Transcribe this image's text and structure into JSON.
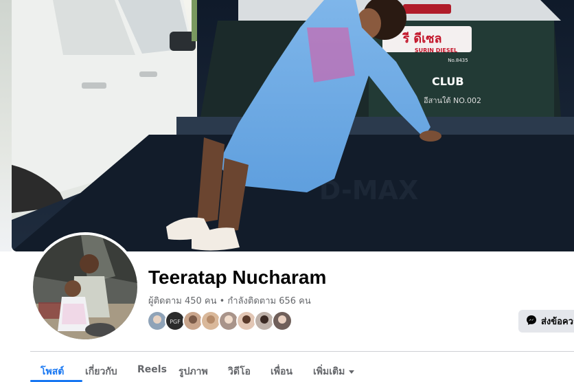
{
  "profile": {
    "name": "Teeratap Nucharam",
    "stats": "ผู้ติดตาม 450 คน • กำลังติดตาม 656 คน"
  },
  "cover": {
    "sign_top": "รี ดีเซล",
    "sign_sub": "SURIN DIESEL",
    "sign_num": "No.8435",
    "club": "CLUB",
    "club_sub": "อีสานใต้ NO.002",
    "tailgate": "D-MAX"
  },
  "actions": {
    "message_label": "ส่งข้อความ"
  },
  "friends": {
    "avatars": [
      "friend-avatar-1",
      "friend-avatar-2",
      "friend-avatar-3",
      "friend-avatar-4",
      "friend-avatar-5",
      "friend-avatar-6",
      "friend-avatar-7",
      "friend-avatar-8"
    ],
    "colors": [
      "#8fa3b8",
      "#2b2b2b",
      "#c9a58c",
      "#d9b89a",
      "#a9948a",
      "#e2c6b4",
      "#bfb2aa",
      "#6f5f5a"
    ],
    "second_label": "PGF"
  },
  "tabs": [
    {
      "label": "โพสต์",
      "active": true
    },
    {
      "label": "เกี่ยวกับ",
      "active": false
    },
    {
      "label": "Reels",
      "active": false
    },
    {
      "label": "รูปภาพ",
      "active": false
    },
    {
      "label": "วิดีโอ",
      "active": false
    },
    {
      "label": "เพื่อน",
      "active": false
    },
    {
      "label": "เพิ่มเติม",
      "active": false
    }
  ],
  "colors": {
    "accent": "#1877f2",
    "muted_text": "#65676b",
    "button_bg": "#e4e6eb"
  }
}
